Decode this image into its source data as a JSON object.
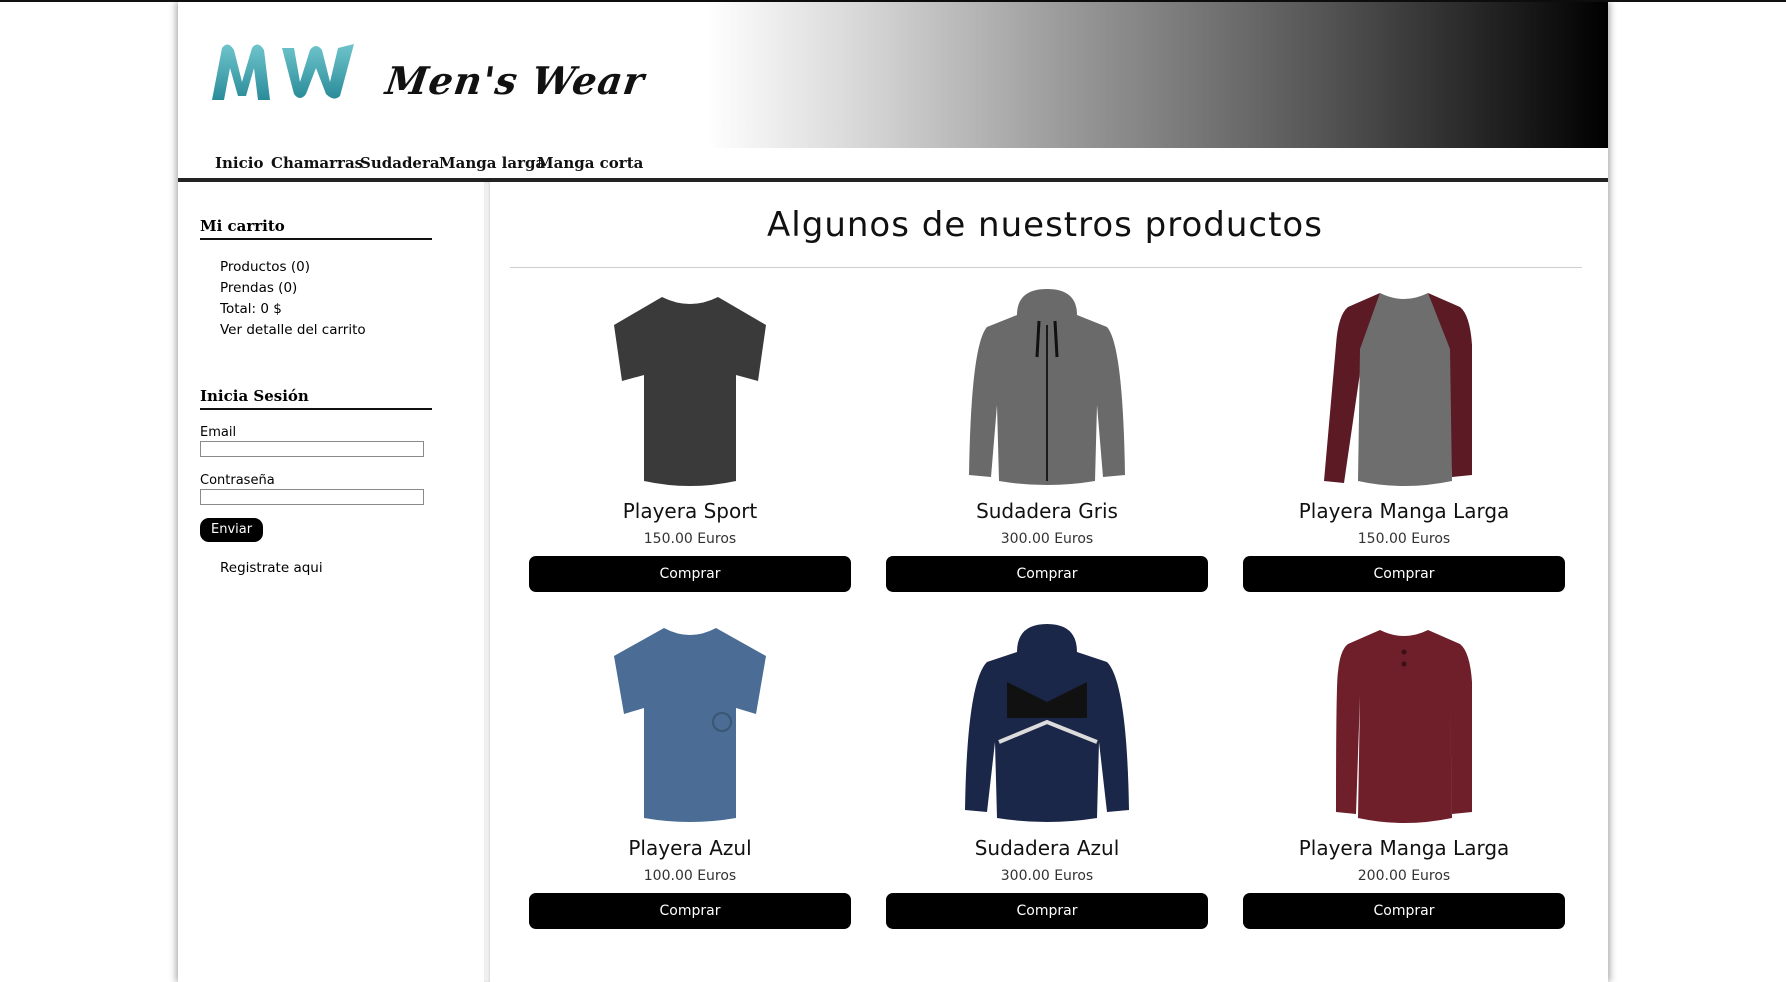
{
  "brand": {
    "logo_text": "MW",
    "name": "Men's Wear"
  },
  "nav": {
    "items": [
      "Inicio",
      "Chamarras",
      "Sudadera",
      "Manga larga",
      "Manga corta"
    ]
  },
  "sidebar": {
    "cart": {
      "title": "Mi carrito",
      "products": "Productos (0)",
      "items": "Prendas (0)",
      "total": "Total: 0 $",
      "detail_link": "Ver detalle del carrito"
    },
    "login": {
      "title": "Inicia Sesión",
      "email_label": "Email",
      "password_label": "Contraseña",
      "submit_label": "Enviar",
      "register_link": "Registrate aqui"
    }
  },
  "main": {
    "title": "Algunos de nuestros productos",
    "buy_label": "Comprar",
    "products": [
      {
        "name": "Playera Sport",
        "price": "150.00 Euros",
        "icon": "short-sleeve-shirt-icon",
        "color": "#3a3a3a"
      },
      {
        "name": "Sudadera Gris",
        "price": "300.00 Euros",
        "icon": "hoodie-icon",
        "color": "#6a6a6a"
      },
      {
        "name": "Playera Manga Larga",
        "price": "150.00 Euros",
        "icon": "raglan-shirt-icon",
        "color": "#6e6e6e"
      },
      {
        "name": "Playera Azul",
        "price": "100.00 Euros",
        "icon": "short-sleeve-shirt-icon",
        "color": "#4b6d95"
      },
      {
        "name": "Sudadera Azul",
        "price": "300.00 Euros",
        "icon": "hoodie-icon",
        "color": "#1b2748"
      },
      {
        "name": "Playera Manga Larga",
        "price": "200.00 Euros",
        "icon": "long-sleeve-shirt-icon",
        "color": "#6e1f2a"
      }
    ]
  }
}
